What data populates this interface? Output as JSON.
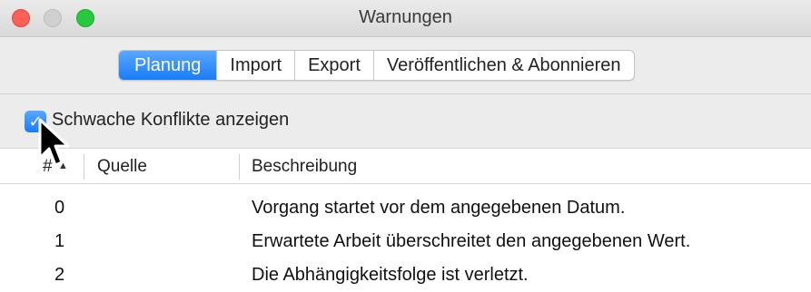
{
  "window": {
    "title": "Warnungen"
  },
  "tabs": [
    {
      "label": "Planung",
      "active": true
    },
    {
      "label": "Import",
      "active": false
    },
    {
      "label": "Export",
      "active": false
    },
    {
      "label": "Veröffentlichen & Abonnieren",
      "active": false
    }
  ],
  "options": {
    "show_weak_conflicts": {
      "label": "Schwache Konflikte anzeigen",
      "checked": true
    }
  },
  "table": {
    "columns": [
      "#",
      "Quelle",
      "Beschreibung"
    ],
    "rows": [
      {
        "num": "0",
        "source": "",
        "description": "Vorgang startet vor dem angegebenen Datum."
      },
      {
        "num": "1",
        "source": "",
        "description": "Erwartete Arbeit überschreitet den angegebenen Wert."
      },
      {
        "num": "2",
        "source": "",
        "description": "Die Abhängigkeitsfolge ist verletzt."
      }
    ]
  },
  "colors": {
    "accent": "#1a7cf5",
    "close": "#fe5f57",
    "zoom": "#28c840"
  },
  "icons": {
    "checkbox_mark": "checkmark-icon",
    "cursor": "mouse-pointer-icon"
  }
}
